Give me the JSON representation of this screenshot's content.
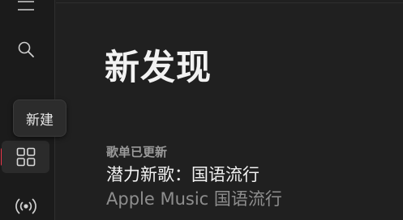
{
  "sidebar": {
    "tooltip": "新建",
    "items": [
      {
        "icon": "menu-icon"
      },
      {
        "icon": "search-icon"
      },
      {
        "icon": "new-icon"
      },
      {
        "icon": "browse-grid-icon",
        "active": true
      },
      {
        "icon": "radio-icon"
      }
    ]
  },
  "main": {
    "title": "新发现",
    "card": {
      "kicker": "歌单已更新",
      "title": "潜力新歌：国语流行",
      "subtitle": "Apple Music 国语流行"
    }
  },
  "colors": {
    "background": "#202020",
    "sidebar": "#1b1b1b",
    "accent": "#f0364a"
  }
}
